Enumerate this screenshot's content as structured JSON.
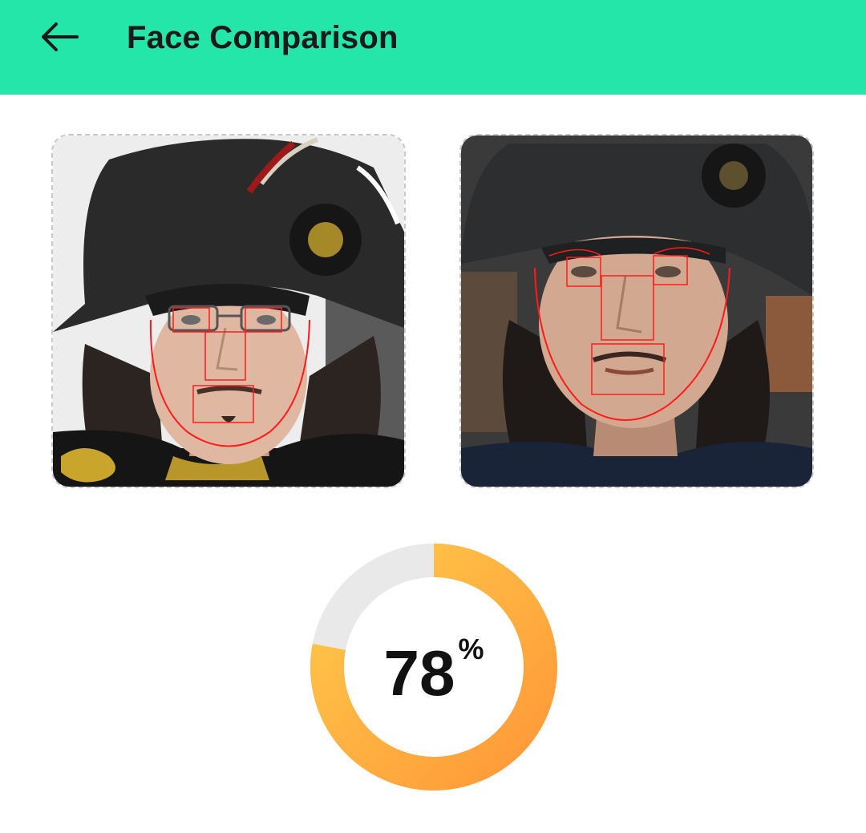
{
  "header": {
    "title": "Face Comparison",
    "back_icon": "arrow-left-icon",
    "background_color": "#24E6A8"
  },
  "photos": [
    {
      "slot": "first-face",
      "has_face_landmarks": true
    },
    {
      "slot": "second-face",
      "has_face_landmarks": true
    }
  ],
  "similarity": {
    "value": "78",
    "unit": "%",
    "fraction": 0.78,
    "ring_colors": {
      "start": "#FFC94A",
      "end": "#FF9838",
      "track": "#E9E9E9"
    }
  }
}
